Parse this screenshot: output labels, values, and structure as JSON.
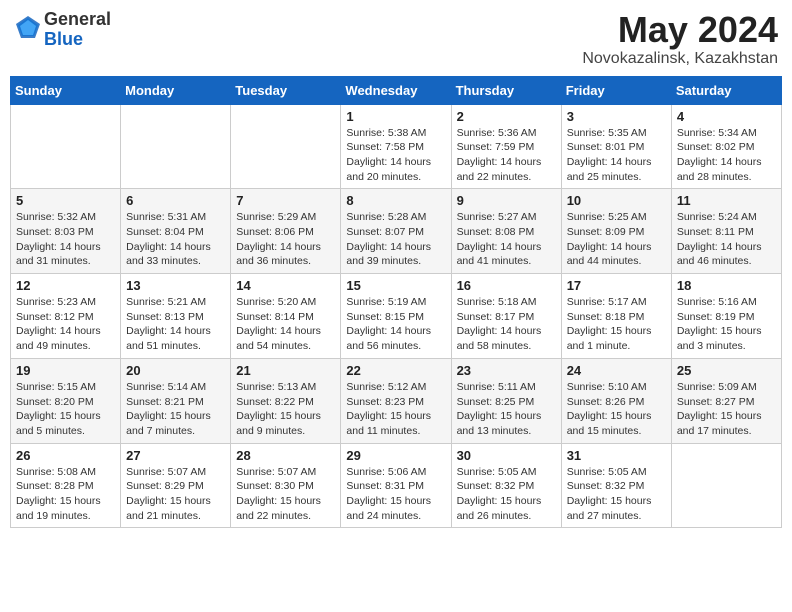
{
  "header": {
    "logo_general": "General",
    "logo_blue": "Blue",
    "month_year": "May 2024",
    "location": "Novokazalinsk, Kazakhstan"
  },
  "weekdays": [
    "Sunday",
    "Monday",
    "Tuesday",
    "Wednesday",
    "Thursday",
    "Friday",
    "Saturday"
  ],
  "weeks": [
    [
      {
        "day": "",
        "info": ""
      },
      {
        "day": "",
        "info": ""
      },
      {
        "day": "",
        "info": ""
      },
      {
        "day": "1",
        "info": "Sunrise: 5:38 AM\nSunset: 7:58 PM\nDaylight: 14 hours\nand 20 minutes."
      },
      {
        "day": "2",
        "info": "Sunrise: 5:36 AM\nSunset: 7:59 PM\nDaylight: 14 hours\nand 22 minutes."
      },
      {
        "day": "3",
        "info": "Sunrise: 5:35 AM\nSunset: 8:01 PM\nDaylight: 14 hours\nand 25 minutes."
      },
      {
        "day": "4",
        "info": "Sunrise: 5:34 AM\nSunset: 8:02 PM\nDaylight: 14 hours\nand 28 minutes."
      }
    ],
    [
      {
        "day": "5",
        "info": "Sunrise: 5:32 AM\nSunset: 8:03 PM\nDaylight: 14 hours\nand 31 minutes."
      },
      {
        "day": "6",
        "info": "Sunrise: 5:31 AM\nSunset: 8:04 PM\nDaylight: 14 hours\nand 33 minutes."
      },
      {
        "day": "7",
        "info": "Sunrise: 5:29 AM\nSunset: 8:06 PM\nDaylight: 14 hours\nand 36 minutes."
      },
      {
        "day": "8",
        "info": "Sunrise: 5:28 AM\nSunset: 8:07 PM\nDaylight: 14 hours\nand 39 minutes."
      },
      {
        "day": "9",
        "info": "Sunrise: 5:27 AM\nSunset: 8:08 PM\nDaylight: 14 hours\nand 41 minutes."
      },
      {
        "day": "10",
        "info": "Sunrise: 5:25 AM\nSunset: 8:09 PM\nDaylight: 14 hours\nand 44 minutes."
      },
      {
        "day": "11",
        "info": "Sunrise: 5:24 AM\nSunset: 8:11 PM\nDaylight: 14 hours\nand 46 minutes."
      }
    ],
    [
      {
        "day": "12",
        "info": "Sunrise: 5:23 AM\nSunset: 8:12 PM\nDaylight: 14 hours\nand 49 minutes."
      },
      {
        "day": "13",
        "info": "Sunrise: 5:21 AM\nSunset: 8:13 PM\nDaylight: 14 hours\nand 51 minutes."
      },
      {
        "day": "14",
        "info": "Sunrise: 5:20 AM\nSunset: 8:14 PM\nDaylight: 14 hours\nand 54 minutes."
      },
      {
        "day": "15",
        "info": "Sunrise: 5:19 AM\nSunset: 8:15 PM\nDaylight: 14 hours\nand 56 minutes."
      },
      {
        "day": "16",
        "info": "Sunrise: 5:18 AM\nSunset: 8:17 PM\nDaylight: 14 hours\nand 58 minutes."
      },
      {
        "day": "17",
        "info": "Sunrise: 5:17 AM\nSunset: 8:18 PM\nDaylight: 15 hours\nand 1 minute."
      },
      {
        "day": "18",
        "info": "Sunrise: 5:16 AM\nSunset: 8:19 PM\nDaylight: 15 hours\nand 3 minutes."
      }
    ],
    [
      {
        "day": "19",
        "info": "Sunrise: 5:15 AM\nSunset: 8:20 PM\nDaylight: 15 hours\nand 5 minutes."
      },
      {
        "day": "20",
        "info": "Sunrise: 5:14 AM\nSunset: 8:21 PM\nDaylight: 15 hours\nand 7 minutes."
      },
      {
        "day": "21",
        "info": "Sunrise: 5:13 AM\nSunset: 8:22 PM\nDaylight: 15 hours\nand 9 minutes."
      },
      {
        "day": "22",
        "info": "Sunrise: 5:12 AM\nSunset: 8:23 PM\nDaylight: 15 hours\nand 11 minutes."
      },
      {
        "day": "23",
        "info": "Sunrise: 5:11 AM\nSunset: 8:25 PM\nDaylight: 15 hours\nand 13 minutes."
      },
      {
        "day": "24",
        "info": "Sunrise: 5:10 AM\nSunset: 8:26 PM\nDaylight: 15 hours\nand 15 minutes."
      },
      {
        "day": "25",
        "info": "Sunrise: 5:09 AM\nSunset: 8:27 PM\nDaylight: 15 hours\nand 17 minutes."
      }
    ],
    [
      {
        "day": "26",
        "info": "Sunrise: 5:08 AM\nSunset: 8:28 PM\nDaylight: 15 hours\nand 19 minutes."
      },
      {
        "day": "27",
        "info": "Sunrise: 5:07 AM\nSunset: 8:29 PM\nDaylight: 15 hours\nand 21 minutes."
      },
      {
        "day": "28",
        "info": "Sunrise: 5:07 AM\nSunset: 8:30 PM\nDaylight: 15 hours\nand 22 minutes."
      },
      {
        "day": "29",
        "info": "Sunrise: 5:06 AM\nSunset: 8:31 PM\nDaylight: 15 hours\nand 24 minutes."
      },
      {
        "day": "30",
        "info": "Sunrise: 5:05 AM\nSunset: 8:32 PM\nDaylight: 15 hours\nand 26 minutes."
      },
      {
        "day": "31",
        "info": "Sunrise: 5:05 AM\nSunset: 8:32 PM\nDaylight: 15 hours\nand 27 minutes."
      },
      {
        "day": "",
        "info": ""
      }
    ]
  ]
}
